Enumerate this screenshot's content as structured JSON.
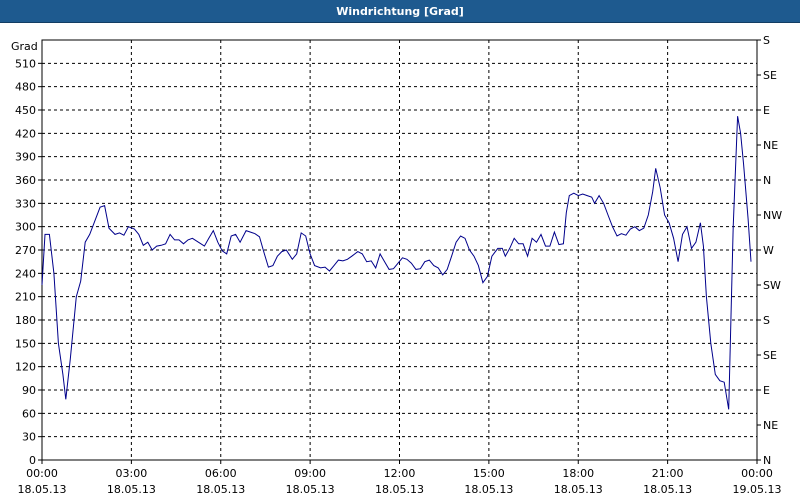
{
  "window": {
    "title": "Windrichtung [Grad]"
  },
  "chart_data": {
    "type": "line",
    "title": "Windrichtung [Grad]",
    "ylabel": "Grad",
    "ylim": [
      0,
      540
    ],
    "yticks": [
      0,
      30,
      60,
      90,
      120,
      150,
      180,
      210,
      240,
      270,
      300,
      330,
      360,
      390,
      420,
      450,
      480,
      510
    ],
    "y2ticks": [
      {
        "value": 0,
        "label": "N"
      },
      {
        "value": 45,
        "label": "NE"
      },
      {
        "value": 90,
        "label": "E"
      },
      {
        "value": 135,
        "label": "SE"
      },
      {
        "value": 180,
        "label": "S"
      },
      {
        "value": 225,
        "label": "SW"
      },
      {
        "value": 270,
        "label": "W"
      },
      {
        "value": 315,
        "label": "NW"
      },
      {
        "value": 360,
        "label": "N"
      },
      {
        "value": 405,
        "label": "NE"
      },
      {
        "value": 450,
        "label": "E"
      },
      {
        "value": 495,
        "label": "SE"
      },
      {
        "value": 540,
        "label": "S"
      }
    ],
    "xlim": [
      0,
      24
    ],
    "xticks": [
      {
        "value": 0,
        "time": "00:00",
        "date": "18.05.13"
      },
      {
        "value": 3,
        "time": "03:00",
        "date": "18.05.13"
      },
      {
        "value": 6,
        "time": "06:00",
        "date": "18.05.13"
      },
      {
        "value": 9,
        "time": "09:00",
        "date": "18.05.13"
      },
      {
        "value": 12,
        "time": "12:00",
        "date": "18.05.13"
      },
      {
        "value": 15,
        "time": "15:00",
        "date": "18.05.13"
      },
      {
        "value": 18,
        "time": "18:00",
        "date": "18.05.13"
      },
      {
        "value": 21,
        "time": "21:00",
        "date": "18.05.13"
      },
      {
        "value": 24,
        "time": "00:00",
        "date": "19.05.13"
      }
    ],
    "grid": true,
    "series": [
      {
        "color": "#00008b",
        "points": [
          [
            0.0,
            225
          ],
          [
            0.1,
            290
          ],
          [
            0.25,
            290
          ],
          [
            0.4,
            240
          ],
          [
            0.55,
            150
          ],
          [
            0.7,
            110
          ],
          [
            0.8,
            78
          ],
          [
            0.95,
            130
          ],
          [
            1.15,
            210
          ],
          [
            1.3,
            230
          ],
          [
            1.45,
            280
          ],
          [
            1.6,
            290
          ],
          [
            1.8,
            310
          ],
          [
            1.95,
            325
          ],
          [
            2.1,
            327
          ],
          [
            2.25,
            298
          ],
          [
            2.45,
            290
          ],
          [
            2.6,
            292
          ],
          [
            2.75,
            289
          ],
          [
            2.9,
            300
          ],
          [
            3.1,
            297
          ],
          [
            3.25,
            290
          ],
          [
            3.4,
            276
          ],
          [
            3.55,
            280
          ],
          [
            3.7,
            270
          ],
          [
            3.85,
            275
          ],
          [
            4.0,
            276
          ],
          [
            4.15,
            278
          ],
          [
            4.3,
            290
          ],
          [
            4.45,
            283
          ],
          [
            4.6,
            283
          ],
          [
            4.75,
            278
          ],
          [
            4.9,
            283
          ],
          [
            5.05,
            285
          ],
          [
            5.25,
            280
          ],
          [
            5.45,
            275
          ],
          [
            5.6,
            285
          ],
          [
            5.75,
            295
          ],
          [
            5.9,
            280
          ],
          [
            6.05,
            269
          ],
          [
            6.2,
            265
          ],
          [
            6.35,
            288
          ],
          [
            6.5,
            290
          ],
          [
            6.65,
            280
          ],
          [
            6.85,
            295
          ],
          [
            7.0,
            293
          ],
          [
            7.15,
            291
          ],
          [
            7.3,
            287
          ],
          [
            7.45,
            267
          ],
          [
            7.6,
            248
          ],
          [
            7.75,
            250
          ],
          [
            7.9,
            262
          ],
          [
            8.05,
            268
          ],
          [
            8.2,
            270
          ],
          [
            8.4,
            258
          ],
          [
            8.55,
            265
          ],
          [
            8.7,
            292
          ],
          [
            8.85,
            288
          ],
          [
            9.0,
            265
          ],
          [
            9.15,
            250
          ],
          [
            9.35,
            247
          ],
          [
            9.5,
            248
          ],
          [
            9.65,
            243
          ],
          [
            9.8,
            250
          ],
          [
            9.95,
            257
          ],
          [
            10.1,
            256
          ],
          [
            10.25,
            258
          ],
          [
            10.4,
            262
          ],
          [
            10.6,
            268
          ],
          [
            10.75,
            265
          ],
          [
            10.9,
            255
          ],
          [
            11.05,
            256
          ],
          [
            11.2,
            247
          ],
          [
            11.35,
            265
          ],
          [
            11.5,
            255
          ],
          [
            11.65,
            245
          ],
          [
            11.8,
            246
          ],
          [
            11.95,
            253
          ],
          [
            12.1,
            260
          ],
          [
            12.25,
            258
          ],
          [
            12.4,
            253
          ],
          [
            12.55,
            245
          ],
          [
            12.7,
            246
          ],
          [
            12.85,
            255
          ],
          [
            13.0,
            257
          ],
          [
            13.15,
            250
          ],
          [
            13.3,
            247
          ],
          [
            13.45,
            238
          ],
          [
            13.6,
            245
          ],
          [
            13.75,
            262
          ],
          [
            13.9,
            280
          ],
          [
            14.05,
            288
          ],
          [
            14.2,
            285
          ],
          [
            14.35,
            270
          ],
          [
            14.5,
            262
          ],
          [
            14.65,
            250
          ],
          [
            14.8,
            228
          ],
          [
            14.95,
            236
          ],
          [
            15.1,
            262
          ],
          [
            15.3,
            272
          ],
          [
            15.45,
            272
          ],
          [
            15.55,
            262
          ],
          [
            15.7,
            272
          ],
          [
            15.85,
            285
          ],
          [
            16.0,
            278
          ],
          [
            16.15,
            278
          ],
          [
            16.3,
            262
          ],
          [
            16.45,
            285
          ],
          [
            16.6,
            280
          ],
          [
            16.75,
            290
          ],
          [
            16.9,
            275
          ],
          [
            17.05,
            275
          ],
          [
            17.2,
            293
          ],
          [
            17.35,
            277
          ],
          [
            17.5,
            278
          ],
          [
            17.6,
            318
          ],
          [
            17.7,
            340
          ],
          [
            17.85,
            343
          ],
          [
            18.0,
            340
          ],
          [
            18.15,
            342
          ],
          [
            18.3,
            340
          ],
          [
            18.45,
            338
          ],
          [
            18.55,
            330
          ],
          [
            18.7,
            340
          ],
          [
            18.85,
            330
          ],
          [
            19.0,
            315
          ],
          [
            19.15,
            300
          ],
          [
            19.3,
            288
          ],
          [
            19.45,
            291
          ],
          [
            19.6,
            289
          ],
          [
            19.75,
            297
          ],
          [
            19.9,
            300
          ],
          [
            20.05,
            295
          ],
          [
            20.2,
            298
          ],
          [
            20.35,
            315
          ],
          [
            20.5,
            345
          ],
          [
            20.6,
            375
          ],
          [
            20.75,
            350
          ],
          [
            20.9,
            315
          ],
          [
            21.05,
            305
          ],
          [
            21.2,
            285
          ],
          [
            21.35,
            255
          ],
          [
            21.5,
            290
          ],
          [
            21.65,
            300
          ],
          [
            21.8,
            272
          ],
          [
            21.95,
            280
          ],
          [
            22.1,
            305
          ],
          [
            22.2,
            275
          ],
          [
            22.3,
            210
          ],
          [
            22.45,
            150
          ],
          [
            22.6,
            110
          ],
          [
            22.75,
            102
          ],
          [
            22.9,
            100
          ],
          [
            23.05,
            65
          ],
          [
            23.2,
            300
          ],
          [
            23.35,
            442
          ],
          [
            23.45,
            420
          ],
          [
            23.55,
            380
          ],
          [
            23.7,
            310
          ],
          [
            23.8,
            255
          ]
        ]
      }
    ]
  }
}
